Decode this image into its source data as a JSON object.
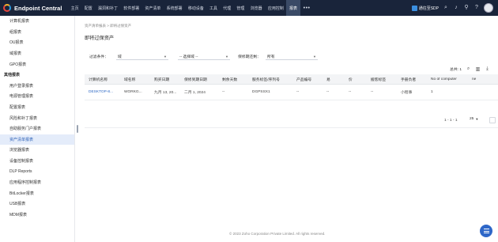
{
  "app": {
    "title": "Endpoint Central"
  },
  "nav": [
    "主页",
    "配置",
    "漏洞和补丁",
    "软件部署",
    "资产清单",
    "系统部署",
    "移动设备",
    "工具",
    "代理",
    "管理",
    "浏览器",
    "应用控制",
    "报表"
  ],
  "nav_active_index": 12,
  "topright": {
    "sdp_label": "通往至SDP"
  },
  "sidebar": {
    "items": [
      {
        "label": "计算机报表",
        "type": "item"
      },
      {
        "label": "组报表",
        "type": "item"
      },
      {
        "label": "OU报表",
        "type": "item"
      },
      {
        "label": "域报表",
        "type": "item"
      },
      {
        "label": "GPO报表",
        "type": "item"
      },
      {
        "label": "其他报表",
        "type": "group"
      },
      {
        "label": "用户登录报表",
        "type": "item"
      },
      {
        "label": "电源管理报表",
        "type": "item"
      },
      {
        "label": "配置报表",
        "type": "item"
      },
      {
        "label": "风险和补丁报表",
        "type": "item"
      },
      {
        "label": "自助服务门户报表",
        "type": "item"
      },
      {
        "label": "资产清单报表",
        "type": "item",
        "active": true
      },
      {
        "label": "浏览器报表",
        "type": "item"
      },
      {
        "label": "设备控制报表",
        "type": "item"
      },
      {
        "label": "DLP Reports",
        "type": "item"
      },
      {
        "label": "应用程序控制报表",
        "type": "item"
      },
      {
        "label": "BitLocker报表",
        "type": "item"
      },
      {
        "label": "USB报表",
        "type": "item"
      },
      {
        "label": "MDM报表",
        "type": "item"
      }
    ]
  },
  "main": {
    "breadcrumb": "资产清单报表 > 即将过保资产",
    "title": "即将过保资产",
    "filters": {
      "label1": "过滤条件：",
      "value1": "域",
      "value2": "-- 选择域 --",
      "label3": "保修期还剩：",
      "value3": "所有"
    },
    "toolbar": {
      "total": "总共: 1"
    },
    "table": {
      "columns": [
        "计算机名称",
        "域名称",
        "购买日期",
        "保修到期日期",
        "剩余天数",
        "服务标签/序列号",
        "产品编号",
        "易",
        "价",
        "搬客标签",
        "手册负者",
        "No of computer",
        "ne"
      ],
      "rows": [
        [
          "DESKTOP-8...",
          "WORKG...",
          "九月 13, 20...",
          "二月 1, 2024",
          "--",
          "DGPSSX1",
          "--",
          "--",
          "--",
          "--",
          "小程事",
          "1",
          ""
        ]
      ]
    },
    "pager": {
      "range": "1 - 1 - 1",
      "page_size": "25"
    }
  },
  "footer": "© 2023 Zoho Corporation Private Limited. All rights reserved."
}
